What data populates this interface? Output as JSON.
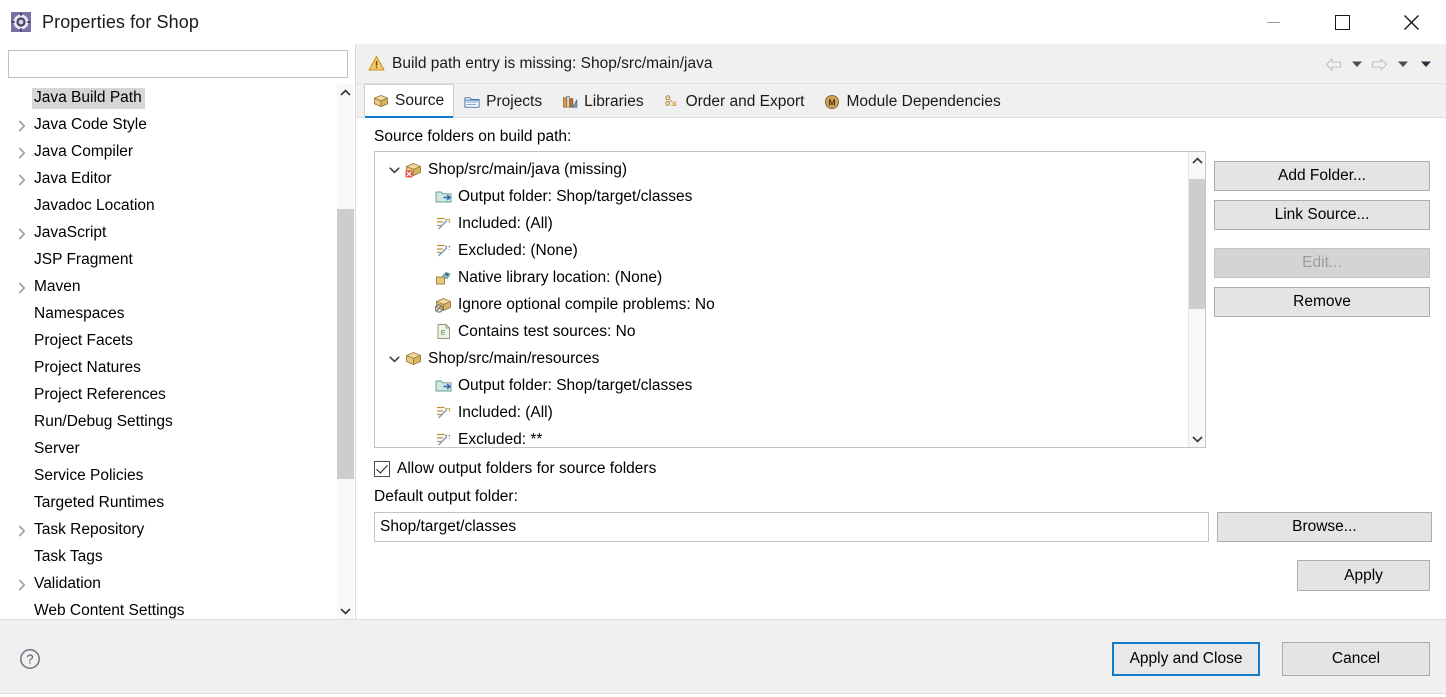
{
  "window": {
    "title": "Properties for Shop",
    "icon": "properties-gear-icon",
    "minimize_label": "Minimize",
    "maximize_label": "Maximize",
    "close_label": "Close"
  },
  "sidebar": {
    "filter_value": "",
    "filter_placeholder": "",
    "items": [
      {
        "label": "Java Build Path",
        "expandable": false,
        "selected": true
      },
      {
        "label": "Java Code Style",
        "expandable": true,
        "selected": false
      },
      {
        "label": "Java Compiler",
        "expandable": true,
        "selected": false
      },
      {
        "label": "Java Editor",
        "expandable": true,
        "selected": false
      },
      {
        "label": "Javadoc Location",
        "expandable": false,
        "selected": false
      },
      {
        "label": "JavaScript",
        "expandable": true,
        "selected": false
      },
      {
        "label": "JSP Fragment",
        "expandable": false,
        "selected": false
      },
      {
        "label": "Maven",
        "expandable": true,
        "selected": false
      },
      {
        "label": "Namespaces",
        "expandable": false,
        "selected": false
      },
      {
        "label": "Project Facets",
        "expandable": false,
        "selected": false
      },
      {
        "label": "Project Natures",
        "expandable": false,
        "selected": false
      },
      {
        "label": "Project References",
        "expandable": false,
        "selected": false
      },
      {
        "label": "Run/Debug Settings",
        "expandable": false,
        "selected": false
      },
      {
        "label": "Server",
        "expandable": false,
        "selected": false
      },
      {
        "label": "Service Policies",
        "expandable": false,
        "selected": false
      },
      {
        "label": "Targeted Runtimes",
        "expandable": false,
        "selected": false
      },
      {
        "label": "Task Repository",
        "expandable": true,
        "selected": false
      },
      {
        "label": "Task Tags",
        "expandable": false,
        "selected": false
      },
      {
        "label": "Validation",
        "expandable": true,
        "selected": false
      },
      {
        "label": "Web Content Settings",
        "expandable": false,
        "selected": false
      }
    ]
  },
  "message_bar": {
    "icon": "warning-icon",
    "text": "Build path entry is missing: Shop/src/main/java",
    "nav": [
      {
        "name": "back-arrow-icon",
        "enabled": false
      },
      {
        "name": "back-dropdown-icon",
        "enabled": true
      },
      {
        "name": "forward-arrow-icon",
        "enabled": false
      },
      {
        "name": "forward-dropdown-icon",
        "enabled": true
      },
      {
        "name": "menu-dropdown-icon",
        "enabled": true
      }
    ]
  },
  "tabs": [
    {
      "label": "Source",
      "icon": "source-folder-icon",
      "active": true
    },
    {
      "label": "Projects",
      "icon": "projects-icon",
      "active": false
    },
    {
      "label": "Libraries",
      "icon": "libraries-icon",
      "active": false
    },
    {
      "label": "Order and Export",
      "icon": "order-export-icon",
      "active": false
    },
    {
      "label": "Module Dependencies",
      "icon": "module-deps-icon",
      "active": false
    }
  ],
  "source_tab": {
    "tree_label": "Source folders on build path:",
    "tree": [
      {
        "label": "Shop/src/main/java (missing)",
        "icon": "source-folder-error-icon",
        "expanded": true,
        "children": [
          {
            "label": "Output folder: Shop/target/classes",
            "icon": "output-folder-icon"
          },
          {
            "label": "Included: (All)",
            "icon": "included-filter-icon"
          },
          {
            "label": "Excluded: (None)",
            "icon": "excluded-filter-icon"
          },
          {
            "label": "Native library location: (None)",
            "icon": "native-library-icon"
          },
          {
            "label": "Ignore optional compile problems: No",
            "icon": "ignore-problems-icon"
          },
          {
            "label": "Contains test sources: No",
            "icon": "test-sources-icon"
          }
        ]
      },
      {
        "label": "Shop/src/main/resources",
        "icon": "source-folder-icon",
        "expanded": true,
        "children": [
          {
            "label": "Output folder: Shop/target/classes",
            "icon": "output-folder-icon"
          },
          {
            "label": "Included: (All)",
            "icon": "included-filter-icon"
          },
          {
            "label": "Excluded: **",
            "icon": "excluded-filter-icon"
          }
        ]
      }
    ],
    "side_buttons": [
      {
        "label": "Add Folder...",
        "enabled": true
      },
      {
        "label": "Link Source...",
        "enabled": true
      },
      {
        "label": "Edit...",
        "enabled": false
      },
      {
        "label": "Remove",
        "enabled": true
      }
    ],
    "allow_output_folders": {
      "label": "Allow output folders for source folders",
      "checked": true
    },
    "default_output_label": "Default output folder:",
    "default_output_value": "Shop/target/classes",
    "browse_label": "Browse...",
    "apply_label": "Apply"
  },
  "footer": {
    "help_icon": "help-question-icon",
    "apply_and_close_label": "Apply and Close",
    "cancel_label": "Cancel"
  },
  "colors": {
    "accent_blue": "#1579c6",
    "tab_underline": "#0a7dd1",
    "dialog_bg": "#f0f0f0",
    "content_bg": "#ffffff",
    "warning_amber": "#e8a33d",
    "selection_grey": "#d6d6d6"
  }
}
